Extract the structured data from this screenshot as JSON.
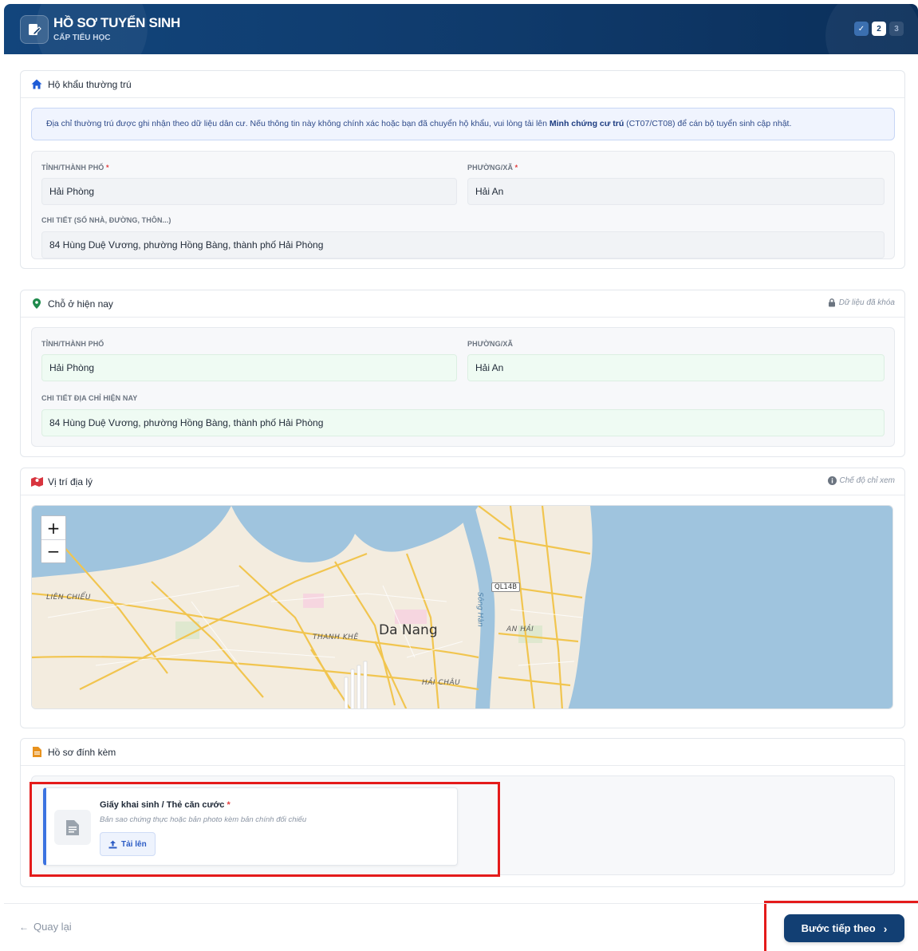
{
  "header": {
    "title": "HỒ SƠ TUYỂN SINH",
    "subtitle": "CẤP TIỂU HỌC",
    "steps": [
      {
        "label": "✓",
        "state": "done"
      },
      {
        "label": "2",
        "state": "active"
      },
      {
        "label": "3",
        "state": "todo"
      }
    ]
  },
  "permanent": {
    "title": "Hộ khẩu thường trú",
    "notice_prefix": "Địa chỉ thường trú được ghi nhận theo dữ liệu dân cư. Nếu thông tin này không chính xác hoặc bạn đã chuyển hộ khẩu, vui lòng tải lên ",
    "notice_bold": "Minh chứng cư trú",
    "notice_suffix": " (CT07/CT08) để cán bộ tuyển sinh cập nhật.",
    "province_label": "TỈNH/THÀNH PHỐ",
    "ward_label": "PHƯỜNG/XÃ",
    "required_mark": "*",
    "province_value": "Hải Phòng",
    "ward_value": "Hải An",
    "detail_label": "CHI TIẾT (SỐ NHÀ, ĐƯỜNG, THÔN...)",
    "detail_value": "84 Hùng Duệ Vương, phường Hồng Bàng, thành phố Hải Phòng"
  },
  "current": {
    "title": "Chỗ ở hiện nay",
    "lock_note": "Dữ liệu đã khóa",
    "province_label": "TỈNH/THÀNH PHỐ",
    "ward_label": "PHƯỜNG/XÃ",
    "province_value": "Hải Phòng",
    "ward_value": "Hải An",
    "detail_label": "CHI TIẾT ĐỊA CHỈ HIỆN NAY",
    "detail_value": "84 Hùng Duệ Vương, phường Hồng Bàng, thành phố Hải Phòng"
  },
  "location": {
    "title": "Vị trí địa lý",
    "view_note": "Chế độ chỉ xem",
    "zoom_in": "+",
    "zoom_out": "−",
    "map_labels": {
      "city": "Da Nang",
      "lien_chieu": "LIÊN CHIỂU",
      "thanh_khe": "THANH KHÊ",
      "hai_chau": "HẢI CHÂU",
      "an_hai": "AN HẢI",
      "road": "QL14B",
      "river": "Sông Hàn"
    }
  },
  "attachments": {
    "title": "Hồ sơ đính kèm",
    "doc_title": "Giấy khai sinh / Thẻ căn cước",
    "required_mark": "*",
    "doc_desc": "Bản sao chứng thực hoặc bản photo kèm bản chính đối chiếu",
    "upload_label": "Tải lên"
  },
  "footer": {
    "back_label": "Quay lại",
    "next_label": "Bước tiếp theo"
  },
  "colors": {
    "header": "#0f3a6b",
    "accent_blue": "#3b72e0",
    "highlight": "#e41b1b",
    "water": "#9fc4de",
    "land": "#f3ecdf",
    "road": "#f1c54f"
  },
  "icons": {
    "logo": "edit-document-icon",
    "permanent": "home-icon",
    "current": "map-pin-icon",
    "location": "map-icon",
    "attachments": "file-icon",
    "lock": "lock-icon",
    "info": "info-icon",
    "doc": "document-icon",
    "upload": "upload-icon",
    "back": "arrow-left-icon",
    "next": "chevron-right-icon"
  }
}
